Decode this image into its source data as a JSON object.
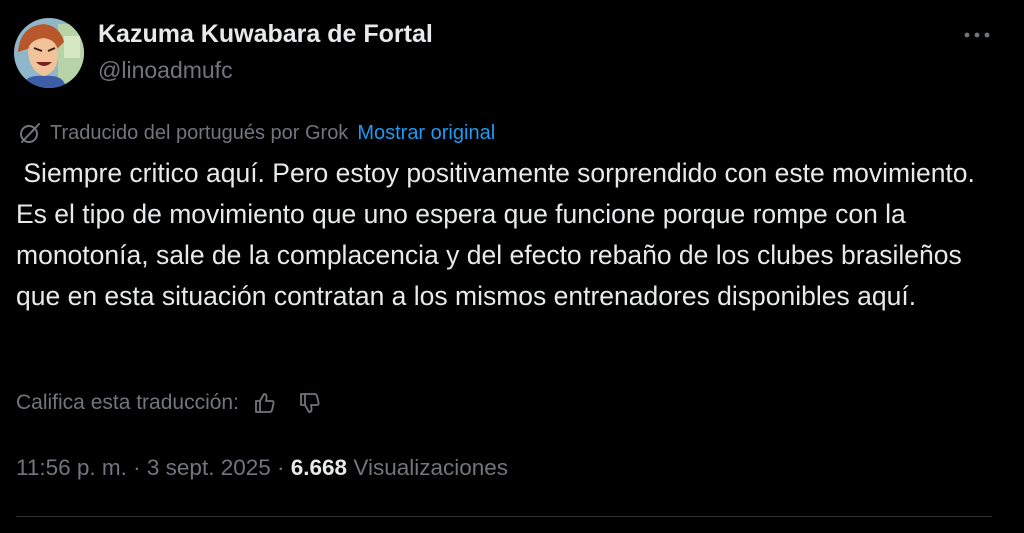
{
  "author": {
    "name": "Kazuma Kuwabara de Fortal",
    "handle": "@linoadmufc"
  },
  "translation": {
    "label": "Traducido del portugués por Grok",
    "show_original": "Mostrar original"
  },
  "tweet": {
    "text": " Siempre critico aquí. Pero estoy positivamente sorprendido con este movimiento. Es el tipo de movimiento que uno espera que funcione porque rompe con la monotonía, sale de la complacencia y del efecto rebaño de los clubes brasileños que en esta situación contratan a los mismos entrenadores disponibles aquí."
  },
  "rating": {
    "label": "Califica esta traducción:"
  },
  "meta": {
    "time": "11:56 p. m.",
    "dot1": " · ",
    "date": "3 sept. 2025",
    "dot2": " · ",
    "views_count": "6.668",
    "views_label": "Visualizaciones"
  },
  "icons": {
    "more": "more-horizontal-icon",
    "grok": "grok-icon",
    "thumbs_up": "thumbs-up-icon",
    "thumbs_down": "thumbs-down-icon"
  },
  "colors": {
    "background": "#000000",
    "primary_text": "#e7e9ea",
    "secondary_text": "#71767b",
    "link": "#1d9bf0",
    "divider": "#2f3336"
  }
}
